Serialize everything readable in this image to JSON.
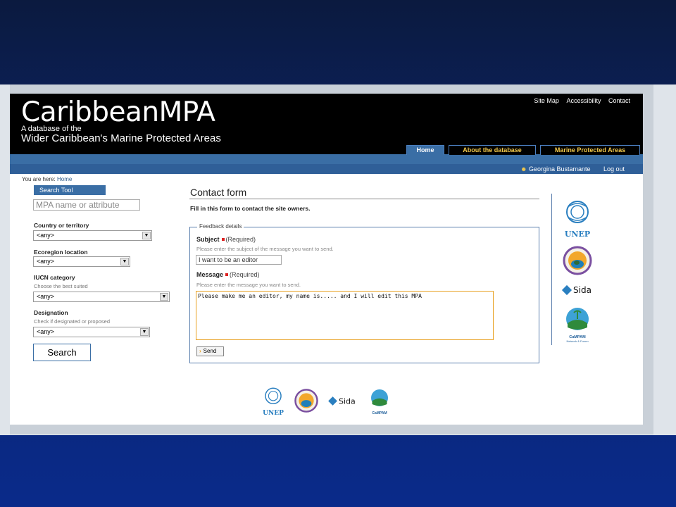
{
  "site": {
    "title": "CaribbeanMPA",
    "subtitle_line1": "A database of the",
    "subtitle_line2": "Wider Caribbean's Marine Protected Areas"
  },
  "top_links": [
    "Site Map",
    "Accessibility",
    "Contact"
  ],
  "nav": {
    "tabs": [
      {
        "label": "Home",
        "active": true
      },
      {
        "label": "About the database",
        "active": false
      },
      {
        "label": "Marine Protected Areas",
        "active": false
      }
    ]
  },
  "user_bar": {
    "user_name": "Georgina Bustamante",
    "logout_label": "Log out"
  },
  "breadcrumb": {
    "prefix": "You are here:",
    "home": "Home"
  },
  "sidebar": {
    "header": "Search Tool",
    "search_placeholder": "MPA name or attribute",
    "country_label": "Country or territory",
    "country_value": "<any>",
    "ecoregion_label": "Ecoregion location",
    "ecoregion_value": "<any>",
    "iucn_label": "IUCN category",
    "iucn_hint": "Choose the best suited",
    "iucn_value": "<any>",
    "designation_label": "Designation",
    "designation_hint": "Check if designated or proposed",
    "designation_value": "<any>",
    "search_button": "Search"
  },
  "form": {
    "title": "Contact form",
    "intro": "Fill in this form to contact the site owners.",
    "legend": "Feedback details",
    "subject_label": "Subject",
    "required_label": "(Required)",
    "subject_hint": "Please enter the subject of the message you want to send.",
    "subject_value": "I want to be an editor",
    "message_label": "Message",
    "message_hint": "Please enter the message you want to send.",
    "message_value": "Please make me an editor, my name is..... and I will edit this MPA",
    "send_button": "Send"
  },
  "partners": {
    "unep": "UNEP",
    "sida": "Sida",
    "campam": "CaMPAM",
    "campam_sub": "Network & Forum"
  },
  "colors": {
    "nav_blue": "#3a6ea5",
    "tab_text": "#f2c94c",
    "required_dot": "#dd2222",
    "textarea_border": "#e8a020"
  }
}
